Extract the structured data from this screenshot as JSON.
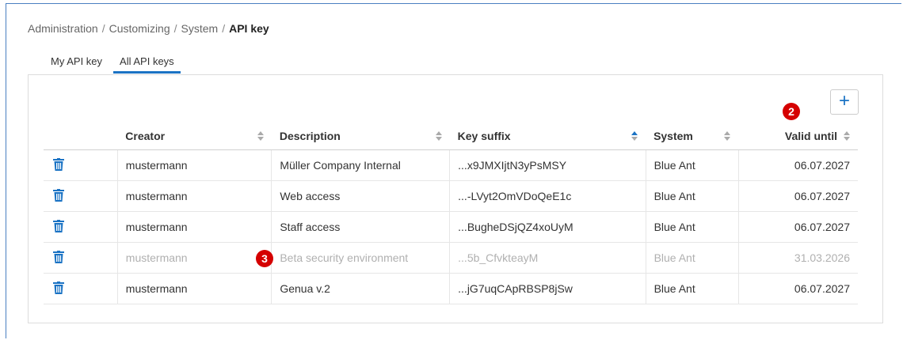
{
  "breadcrumb": {
    "items": [
      "Administration",
      "Customizing",
      "System"
    ],
    "current": "API key",
    "separator": "/"
  },
  "tabs": [
    {
      "label": "My API key",
      "active": false
    },
    {
      "label": "All API keys",
      "active": true
    }
  ],
  "add_button": {
    "label": "+"
  },
  "badges": {
    "two": "2",
    "three": "3"
  },
  "table": {
    "columns": [
      "Creator",
      "Description",
      "Key suffix",
      "System",
      "Valid until"
    ],
    "sorted_column": "Key suffix",
    "rows": [
      {
        "creator": "mustermann",
        "description": "Müller Company Internal",
        "key_suffix": "...x9JMXIjtN3yPsMSY",
        "system": "Blue Ant",
        "valid_until": "06.07.2027",
        "expired": false
      },
      {
        "creator": "mustermann",
        "description": "Web access",
        "key_suffix": "...-LVyt2OmVDoQeE1c",
        "system": "Blue Ant",
        "valid_until": "06.07.2027",
        "expired": false
      },
      {
        "creator": "mustermann",
        "description": "Staff access",
        "key_suffix": "...BugheDSjQZ4xoUyM",
        "system": "Blue Ant",
        "valid_until": "06.07.2027",
        "expired": false
      },
      {
        "creator": "mustermann",
        "description": "Beta security environment",
        "key_suffix": "...5b_CfvkteayM",
        "system": "Blue Ant",
        "valid_until": "31.03.2026",
        "expired": true
      },
      {
        "creator": "mustermann",
        "description": "Genua v.2",
        "key_suffix": "...jG7uqCApRBSP8jSw",
        "system": "Blue Ant",
        "valid_until": "06.07.2027",
        "expired": false
      }
    ]
  },
  "colors": {
    "accent": "#1b73c4",
    "badge": "#d50000",
    "dim_text": "#b0b0b0"
  },
  "icons": {
    "delete": "trash-icon",
    "sort": "sort-icon",
    "add": "plus-icon"
  }
}
